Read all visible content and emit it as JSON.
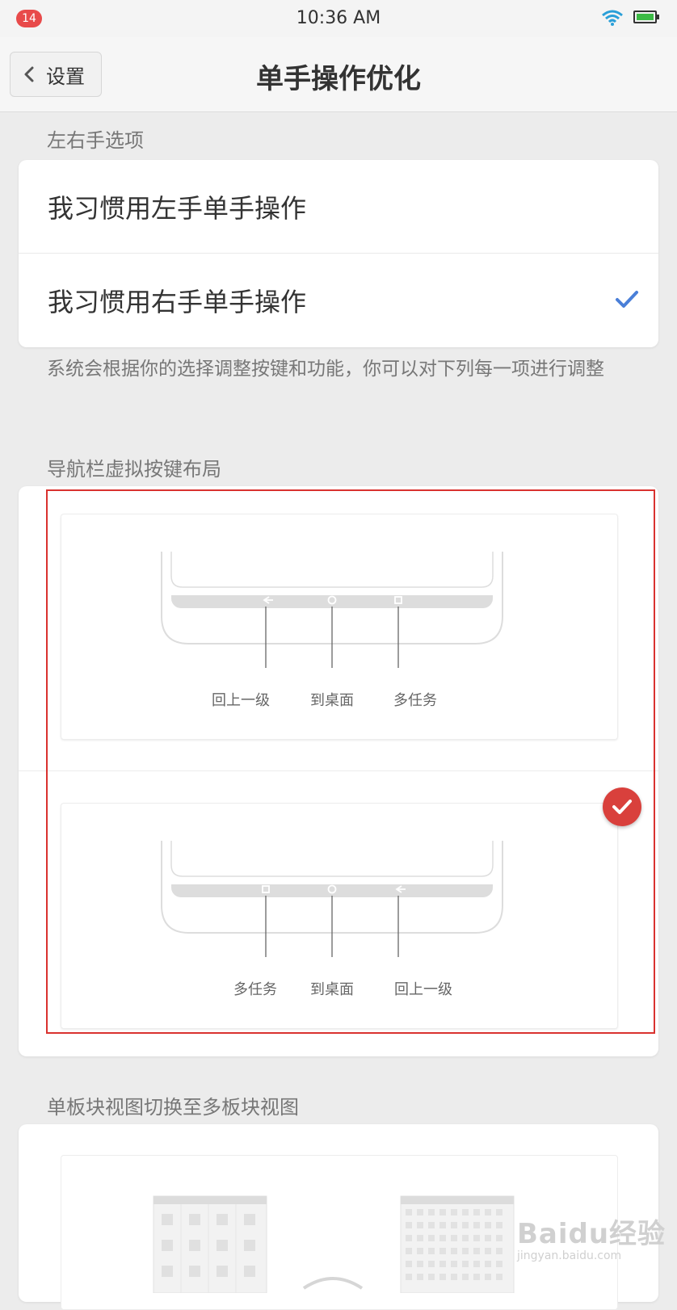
{
  "status_bar": {
    "notification_count": "14",
    "time": "10:36 AM",
    "wifi_icon": "wifi-icon",
    "battery_icon": "battery-icon"
  },
  "header": {
    "back_label": "设置",
    "title": "单手操作优化"
  },
  "hand_section": {
    "label": "左右手选项",
    "options": [
      {
        "label": "我习惯用左手单手操作",
        "selected": false
      },
      {
        "label": "我习惯用右手单手操作",
        "selected": true
      }
    ],
    "description": "系统会根据你的选择调整按键和功能，你可以对下列每一项进行调整"
  },
  "nav_section": {
    "label": "导航栏虚拟按键布局",
    "layouts": [
      {
        "labels": [
          "回上一级",
          "到桌面",
          "多任务"
        ],
        "selected": false
      },
      {
        "labels": [
          "多任务",
          "到桌面",
          "回上一级"
        ],
        "selected": true
      }
    ]
  },
  "view_section": {
    "label": "单板块视图切换至多板块视图"
  },
  "watermark": {
    "main": "Baidu经验",
    "sub": "jingyan.baidu.com"
  },
  "colors": {
    "accent_check": "#4a7fd8",
    "highlight_red": "#d9322f",
    "selected_badge": "#d9403c"
  }
}
